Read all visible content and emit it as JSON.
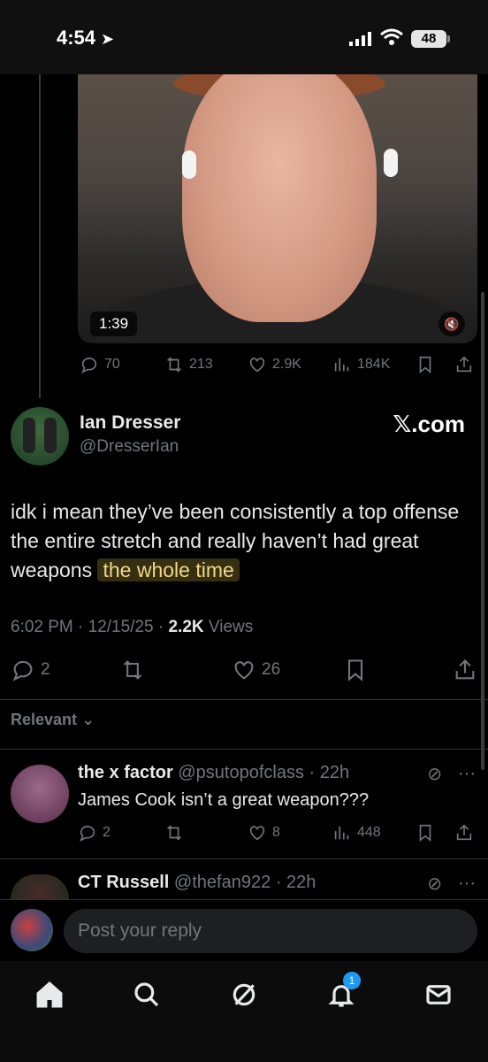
{
  "status_bar": {
    "time": "4:54",
    "location_glyph": "➤",
    "battery": "48"
  },
  "video": {
    "duration": "1:39",
    "mute_icon": "speaker-muted-icon"
  },
  "quoted_actions": {
    "replies": "70",
    "reposts": "213",
    "likes": "2.9K",
    "views": "184K"
  },
  "tweet": {
    "name": "Ian Dresser",
    "handle": "@DresserIan",
    "watermark": "𝕏.com",
    "text_main": "idk i mean they’ve been consistently a top offense the entire stretch and really haven’t had great weapons ",
    "text_highlight": "the whole time",
    "time": "6:02 PM · 12/15/25 · ",
    "views_count": "2.2K",
    "views_label": " Views",
    "replies": "2",
    "likes": "26"
  },
  "sort_label": "Relevant",
  "replies": [
    {
      "name": "the x factor",
      "meta": " @psutopofclass · 22h",
      "text": "James Cook isn’t a great weapon???",
      "replies": "2",
      "likes": "8",
      "views": "448"
    },
    {
      "name": "CT Russell",
      "meta": " @thefan922 · 22h"
    }
  ],
  "reply_input": {
    "placeholder": "Post your reply"
  },
  "tabbar": {
    "notifications_badge": "1"
  }
}
